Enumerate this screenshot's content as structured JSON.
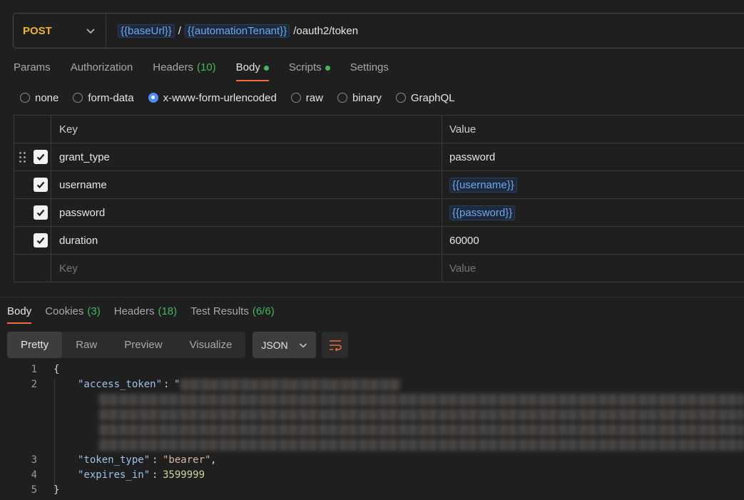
{
  "request": {
    "method": "POST",
    "url_vars": [
      "{{baseUrl}}",
      "{{automationTenant}}"
    ],
    "url_sep": "/",
    "url_path": "/oauth2/token"
  },
  "req_tabs": [
    {
      "label": "Params"
    },
    {
      "label": "Authorization"
    },
    {
      "label": "Headers",
      "count": "(10)"
    },
    {
      "label": "Body",
      "dot": true,
      "active": true
    },
    {
      "label": "Scripts",
      "dot": true
    },
    {
      "label": "Settings"
    }
  ],
  "body_types": [
    {
      "label": "none"
    },
    {
      "label": "form-data"
    },
    {
      "label": "x-www-form-urlencoded",
      "selected": true
    },
    {
      "label": "raw"
    },
    {
      "label": "binary"
    },
    {
      "label": "GraphQL"
    }
  ],
  "table": {
    "headers": {
      "key": "Key",
      "value": "Value"
    },
    "rows": [
      {
        "key": "grant_type",
        "value": "password",
        "checked": true
      },
      {
        "key": "username",
        "value": "{{username}}",
        "checked": true,
        "is_var": true
      },
      {
        "key": "password",
        "value": "{{password}}",
        "checked": true,
        "is_var": true
      },
      {
        "key": "duration",
        "value": "60000",
        "checked": true
      }
    ],
    "placeholder": {
      "key": "Key",
      "value": "Value"
    }
  },
  "res_tabs": [
    {
      "label": "Body",
      "active": true
    },
    {
      "label": "Cookies",
      "count": "(3)"
    },
    {
      "label": "Headers",
      "count": "(18)"
    },
    {
      "label": "Test Results",
      "count": "(6/6)"
    }
  ],
  "view_modes": [
    "Pretty",
    "Raw",
    "Preview",
    "Visualize"
  ],
  "format": "JSON",
  "code": {
    "line_numbers": [
      "1",
      "2",
      "3",
      "4",
      "5"
    ],
    "open_brace": "{",
    "close_brace": "}",
    "access_token_key": "\"access_token\"",
    "access_token_open": "\"",
    "token_type_key": "\"token_type\"",
    "token_type_value": "\"bearer\"",
    "expires_in_key": "\"expires_in\"",
    "expires_in_value": "3599999"
  }
}
